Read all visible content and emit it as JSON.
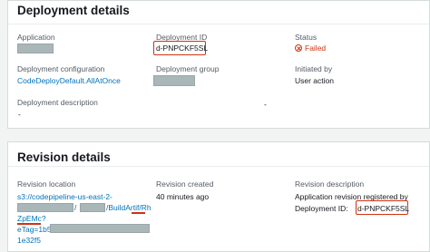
{
  "deployment_details": {
    "title": "Deployment details",
    "application": {
      "label": "Application",
      "value": ""
    },
    "deployment_id": {
      "label": "Deployment ID",
      "value": "d-PNPCKF5SL"
    },
    "status": {
      "label": "Status",
      "value": "Failed"
    },
    "deployment_configuration": {
      "label": "Deployment configuration",
      "value": "CodeDeployDefault.AllAtOnce"
    },
    "deployment_group": {
      "label": "Deployment group",
      "value": ""
    },
    "initiated_by": {
      "label": "Initiated by",
      "value": "User action"
    },
    "deployment_description": {
      "label": "Deployment description",
      "value": "-"
    },
    "extra_dash": "-"
  },
  "revision_details": {
    "title": "Revision details",
    "revision_location": {
      "label": "Revision location",
      "line1": "s3://codepipeline-us-east-2-",
      "line2_suffix": "/BuildArtif/Rh",
      "line3": "ZpEMc?",
      "line4_prefix": "eTag=1b5",
      "line5": "1e32f5"
    },
    "revision_created": {
      "label": "Revision created",
      "value": "40 minutes ago"
    },
    "revision_description": {
      "label": "Revision description",
      "line1": "Application revision registered by",
      "line2_prefix": "Deployment ID: ",
      "line2_id": "d-PNPCKF5SL"
    }
  },
  "colors": {
    "failed": "#d13212",
    "link": "#0073bb",
    "highlight": "#d13212"
  }
}
